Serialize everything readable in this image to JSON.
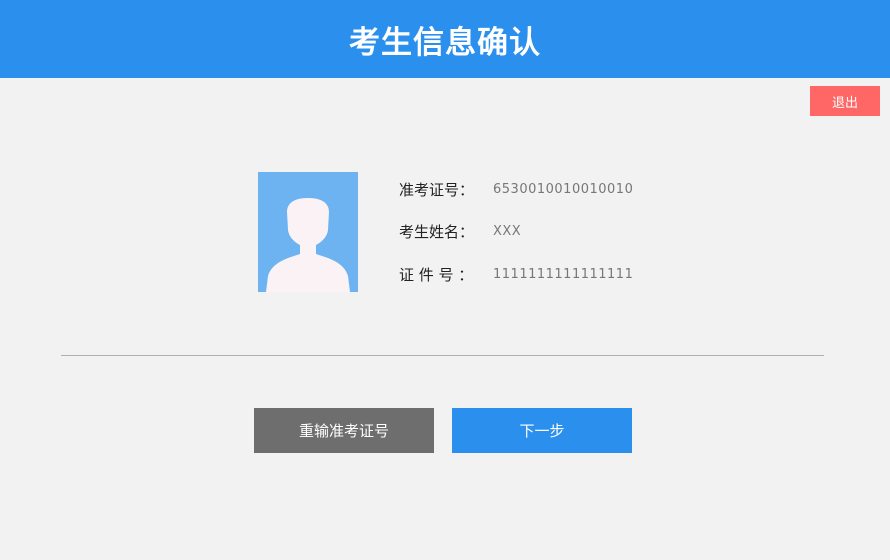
{
  "header": {
    "title": "考生信息确认"
  },
  "toolbar": {
    "exit_label": "退出"
  },
  "candidate": {
    "photo_icon": "avatar-silhouette-icon",
    "fields": [
      {
        "label": "准考证号：",
        "value": "6530010010010010"
      },
      {
        "label": "考生姓名：",
        "value": "XXX"
      },
      {
        "label": "证 件 号 ：",
        "value": "1111111111111111"
      }
    ]
  },
  "actions": {
    "reenter_label": "重输准考证号",
    "next_label": "下一步"
  },
  "colors": {
    "header_bg": "#2b8fed",
    "exit_bg": "#ff6666",
    "photo_bg": "#6db3f2",
    "reenter_bg": "#6e6e6e",
    "next_bg": "#2b8fed",
    "page_bg": "#f2f2f2"
  }
}
